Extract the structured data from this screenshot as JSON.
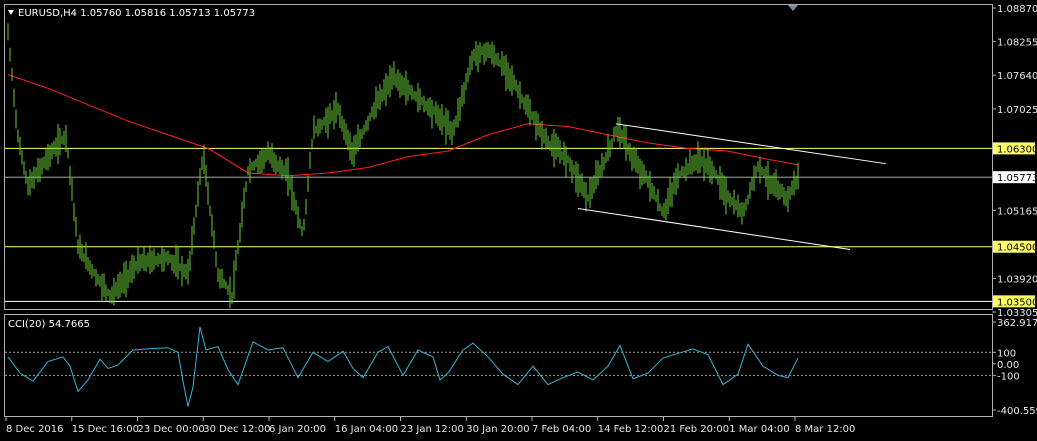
{
  "chart_data": [
    {
      "type": "candlestick",
      "symbol_header": "EURUSD,H4  1.05760 1.05816 1.05713 1.05773",
      "y_ticks": [
        "1.08870",
        "1.08255",
        "1.07640",
        "1.07025",
        "1.06300",
        "1.05773",
        "1.05165",
        "1.04500",
        "1.03920",
        "1.03500",
        "1.03305"
      ],
      "ylim": [
        1.03305,
        1.0887
      ],
      "x_ticks": [
        "8 Dec 2016",
        "15 Dec 16:00",
        "23 Dec 00:00",
        "30 Dec 12:00",
        "6 Jan 20:00",
        "16 Jan 04:00",
        "23 Jan 12:00",
        "30 Jan 20:00",
        "7 Feb 04:00",
        "14 Feb 12:00",
        "21 Feb 20:00",
        "1 Mar 04:00",
        "8 Mar 12:00"
      ],
      "horizontal_levels": [
        {
          "value": 1.063,
          "label": "1.06300",
          "color": "#ffff66"
        },
        {
          "value": 1.045,
          "label": "1.04500",
          "color": "#ffff66"
        },
        {
          "value": 1.035,
          "label": "1.03500",
          "color": "#ffffff"
        }
      ],
      "current_price": {
        "value": 1.05773,
        "label": "1.05773",
        "color": "#c0c0c0"
      },
      "moving_average": {
        "color": "#ff2020",
        "x": [
          0,
          40,
          80,
          120,
          160,
          200,
          240,
          280,
          320,
          360,
          400,
          440,
          480,
          520,
          560,
          600,
          640,
          680,
          720,
          760,
          790
        ],
        "y": [
          1.0765,
          1.074,
          1.071,
          1.068,
          1.0655,
          1.063,
          1.0585,
          1.058,
          1.0585,
          1.0595,
          1.0615,
          1.0625,
          1.0655,
          1.0675,
          1.067,
          1.0655,
          1.064,
          1.063,
          1.0625,
          1.061,
          1.06
        ]
      },
      "price_path": {
        "color": "#66cc33",
        "x": [
          0,
          10,
          20,
          40,
          58,
          70,
          90,
          103,
          130,
          160,
          180,
          195,
          210,
          224,
          240,
          260,
          280,
          295,
          305,
          330,
          345,
          365,
          385,
          405,
          425,
          445,
          465,
          480,
          500,
          520,
          540,
          560,
          580,
          595,
          610,
          625,
          640,
          655,
          670,
          690,
          705,
          720,
          735,
          750,
          765,
          780,
          790
        ],
        "y": [
          1.084,
          1.065,
          1.056,
          1.0615,
          1.0655,
          1.045,
          1.039,
          1.036,
          1.042,
          1.043,
          1.04,
          1.062,
          1.04,
          1.036,
          1.059,
          1.062,
          1.058,
          1.047,
          1.066,
          1.07,
          1.062,
          1.07,
          1.076,
          1.073,
          1.07,
          1.066,
          1.08,
          1.081,
          1.077,
          1.07,
          1.064,
          1.061,
          1.054,
          1.06,
          1.067,
          1.061,
          1.057,
          1.051,
          1.058,
          1.061,
          1.059,
          1.054,
          1.051,
          1.06,
          1.056,
          1.054,
          1.058
        ]
      },
      "trend_lines": [
        {
          "x": [
            608,
            878
          ],
          "y": [
            1.0675,
            1.0602
          ],
          "color": "#ffffff"
        },
        {
          "x": [
            570,
            842
          ],
          "y": [
            1.052,
            1.0445
          ],
          "color": "#ffffff"
        }
      ]
    },
    {
      "type": "line",
      "indicator_header": "CCI(20) 54.7665",
      "y_ticks": [
        "362.9172",
        "100",
        "0.00",
        "-100",
        "-400.5593"
      ],
      "ylim": [
        -400.5593,
        362.9172
      ],
      "reference_levels": [
        100,
        -100
      ],
      "series": [
        {
          "color": "#33b4d4",
          "x": [
            0,
            12,
            25,
            40,
            55,
            62,
            70,
            80,
            92,
            100,
            110,
            125,
            140,
            160,
            170,
            175,
            180,
            185,
            192,
            198,
            210,
            220,
            230,
            245,
            260,
            275,
            290,
            305,
            320,
            335,
            345,
            355,
            370,
            380,
            395,
            410,
            425,
            432,
            440,
            455,
            465,
            480,
            495,
            510,
            525,
            540,
            555,
            570,
            585,
            600,
            612,
            625,
            640,
            655,
            670,
            685,
            700,
            715,
            730,
            740,
            755,
            770,
            780,
            790
          ],
          "y": [
            60,
            -80,
            -150,
            20,
            60,
            -20,
            -240,
            -140,
            40,
            -40,
            -10,
            120,
            130,
            140,
            100,
            -150,
            -370,
            -200,
            320,
            120,
            150,
            -50,
            -180,
            190,
            120,
            140,
            -120,
            100,
            20,
            110,
            -40,
            -120,
            100,
            150,
            -100,
            120,
            60,
            -140,
            -80,
            120,
            180,
            60,
            -90,
            -180,
            -20,
            -180,
            -120,
            -70,
            -140,
            -20,
            160,
            -130,
            -80,
            50,
            90,
            130,
            80,
            -180,
            -90,
            170,
            -20,
            -100,
            -120,
            50
          ]
        }
      ]
    }
  ]
}
